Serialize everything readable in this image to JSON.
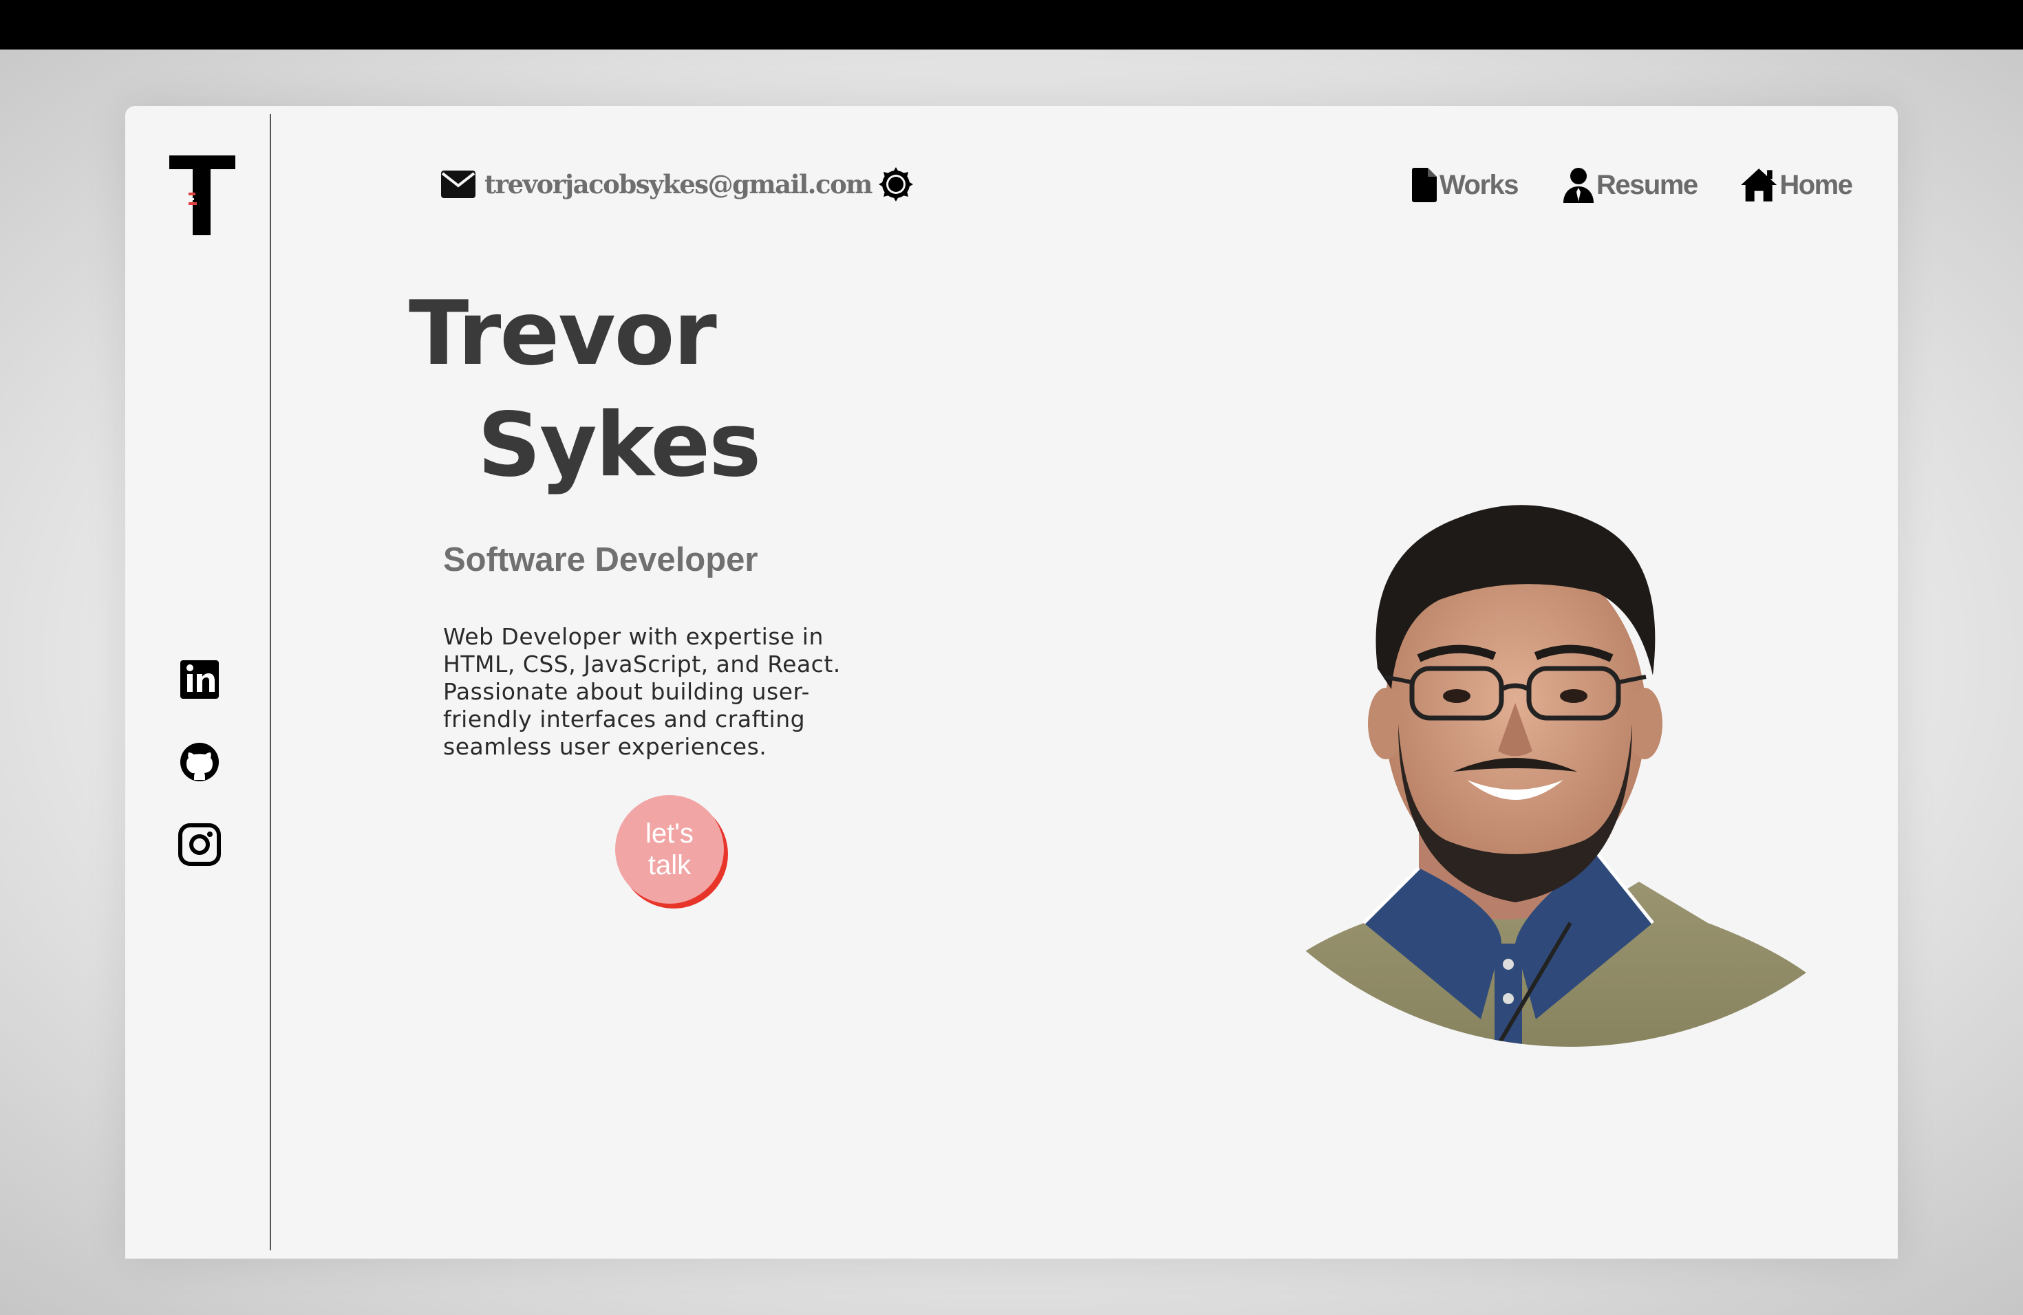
{
  "header": {
    "email": "trevorjacobsykes@gmail.com",
    "nav": [
      {
        "label": "Works",
        "icon": "document-icon"
      },
      {
        "label": "Resume",
        "icon": "user-icon"
      },
      {
        "label": "Home",
        "icon": "home-icon"
      }
    ],
    "theme_toggle_icon": "theme-toggle-icon"
  },
  "sidebar": {
    "logo_icon": "t-logo-icon",
    "social": [
      {
        "name": "LinkedIn",
        "icon": "linkedin-icon"
      },
      {
        "name": "GitHub",
        "icon": "github-icon"
      },
      {
        "name": "Instagram",
        "icon": "instagram-icon"
      }
    ]
  },
  "hero": {
    "first_name": "Trevor",
    "last_name": "Sykes",
    "role": "Software Developer",
    "bio": "Web Developer with expertise in HTML, CSS, JavaScript, and React. Passionate about building user-friendly interfaces and crafting seamless user experiences.",
    "cta_label": "let's talk"
  },
  "colors": {
    "background": "#f5f5f5",
    "heading": "#3a3a3a",
    "nav_text": "#6b6b6b",
    "cta_fill": "#f2a5a5",
    "cta_shadow": "#e8352a",
    "shirt": "#8f8a63",
    "collar": "#2f4a7a"
  }
}
